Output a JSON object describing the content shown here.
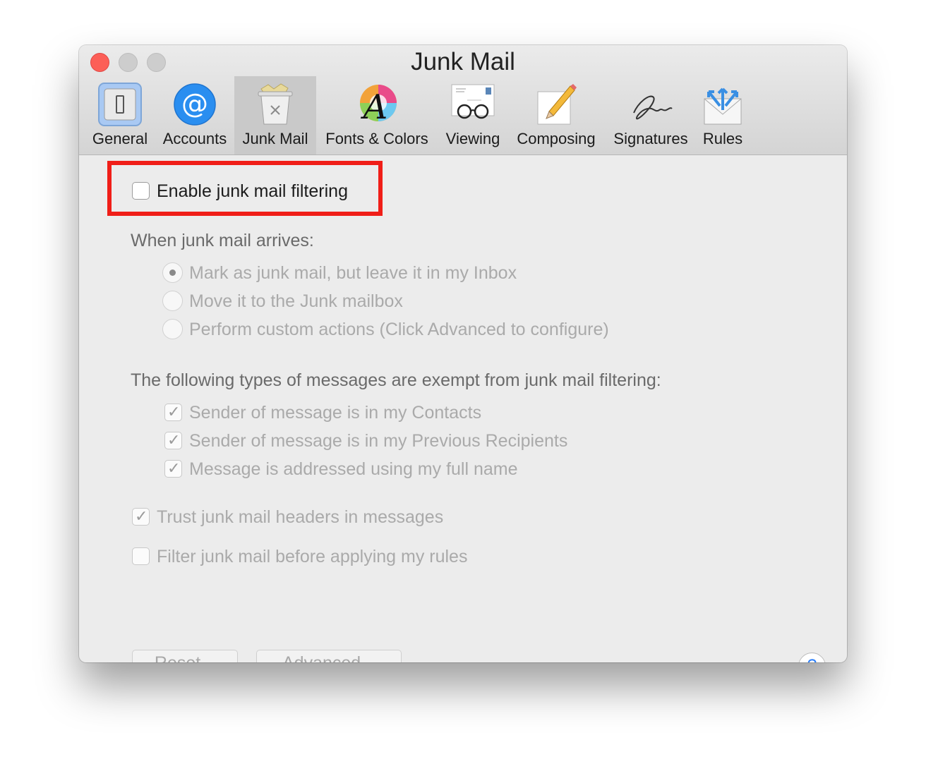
{
  "window": {
    "title": "Junk Mail"
  },
  "tabs": [
    {
      "label": "General",
      "icon": "general-switch-icon",
      "selected": false
    },
    {
      "label": "Accounts",
      "icon": "at-sign-icon",
      "selected": false
    },
    {
      "label": "Junk Mail",
      "icon": "trash-can-icon",
      "selected": true
    },
    {
      "label": "Fonts & Colors",
      "icon": "font-color-wheel-icon",
      "selected": false
    },
    {
      "label": "Viewing",
      "icon": "glasses-envelope-icon",
      "selected": false
    },
    {
      "label": "Composing",
      "icon": "pencil-paper-icon",
      "selected": false
    },
    {
      "label": "Signatures",
      "icon": "signature-icon",
      "selected": false
    },
    {
      "label": "Rules",
      "icon": "envelope-arrows-icon",
      "selected": false
    }
  ],
  "enable_filtering": {
    "label": "Enable junk mail filtering",
    "checked": false
  },
  "arrival": {
    "heading": "When junk mail arrives:",
    "options": [
      {
        "label": "Mark as junk mail, but leave it in my Inbox",
        "selected": true
      },
      {
        "label": "Move it to the Junk mailbox",
        "selected": false
      },
      {
        "label": "Perform custom actions (Click Advanced to configure)",
        "selected": false
      }
    ]
  },
  "exempt": {
    "heading": "The following types of messages are exempt from junk mail filtering:",
    "options": [
      {
        "label": "Sender of message is in my Contacts",
        "checked": true
      },
      {
        "label": "Sender of message is in my Previous Recipients",
        "checked": true
      },
      {
        "label": "Message is addressed using my full name",
        "checked": true
      }
    ]
  },
  "trust_headers": {
    "label": "Trust junk mail headers in messages",
    "checked": true
  },
  "filter_before_rules": {
    "label": "Filter junk mail before applying my rules",
    "checked": false
  },
  "buttons": {
    "reset": "Reset...",
    "advanced": "Advanced...",
    "help": "?"
  },
  "colors": {
    "highlight": "#f01e18",
    "close_button": "#fc5f57",
    "help_accent": "#2d7ff9"
  }
}
